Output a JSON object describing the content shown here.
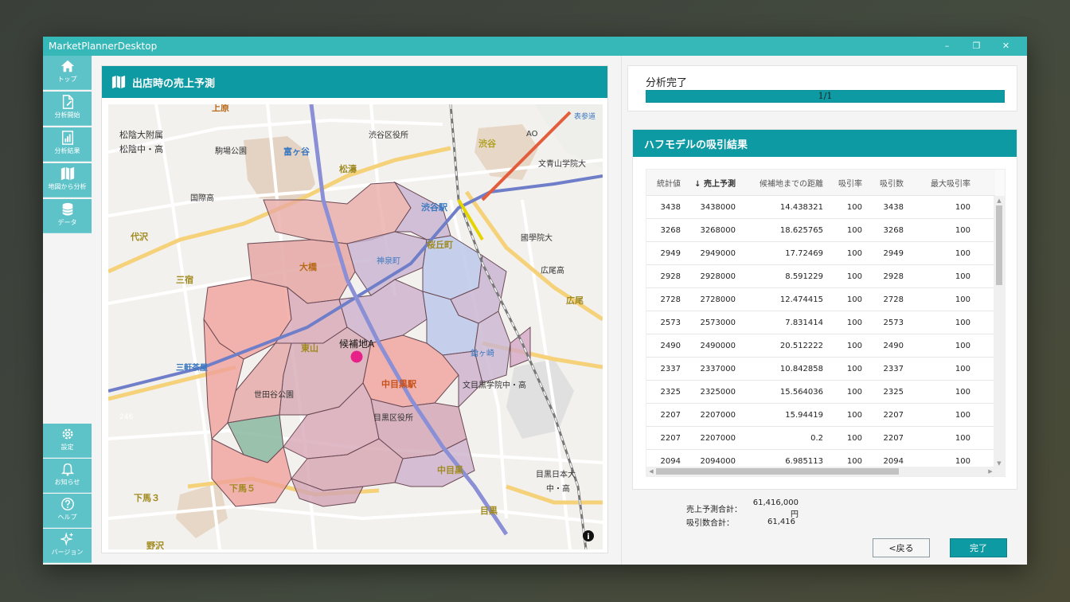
{
  "window": {
    "title": "MarketPlannerDesktop"
  },
  "title_controls": {
    "minimize": "–",
    "restore": "❐",
    "close": "✕"
  },
  "sidebar": {
    "top_items": [
      {
        "label": "トップ",
        "icon": "home-icon"
      },
      {
        "label": "分析開始",
        "icon": "file-edit-icon"
      },
      {
        "label": "分析結果",
        "icon": "report-icon"
      },
      {
        "label": "地図から分析",
        "icon": "map-icon"
      },
      {
        "label": "データ",
        "icon": "database-icon"
      }
    ],
    "bottom_items": [
      {
        "label": "設定",
        "icon": "gear-icon"
      },
      {
        "label": "お知らせ",
        "icon": "bell-icon"
      },
      {
        "label": "ヘルプ",
        "icon": "help-icon"
      },
      {
        "label": "バージョン",
        "icon": "sparkle-icon"
      }
    ]
  },
  "map_panel": {
    "title": "出店時の売上予測",
    "candidate_label": "候補地A",
    "places": {
      "p1": "上原",
      "p2": "松陰大附属",
      "p3": "松陰中・高",
      "p4": "駒場公園",
      "p5": "富ヶ谷",
      "p6": "渋谷区役所",
      "p7": "渋谷",
      "p8": "表参道",
      "p9": "松濤",
      "p10": "文青山学院大",
      "p11": "国際高",
      "p12": "渋谷駅",
      "p13": "代沢",
      "p14": "桜丘町",
      "p15": "國學院大",
      "p16": "三宿",
      "p17": "大橋",
      "p18": "神泉町",
      "p19": "広尾高",
      "p20": "広尾",
      "p21": "三軒茶屋",
      "p22": "東山",
      "p23": "中目黒駅",
      "p24": "鎗ヶ崎",
      "p25": "世田谷公園",
      "p26": "文目黒学院中・高",
      "p27": "目黒区役所",
      "p28": "中目黒",
      "p29": "下馬３",
      "p30": "下馬５",
      "p31": "目黒",
      "p32": "目黒日本大",
      "p33": "中・高",
      "p34": "野沢",
      "p35": "246",
      "p36": "AO"
    },
    "info_icon_label": "i"
  },
  "progress": {
    "status": "分析完了",
    "text": "1/1",
    "fraction": 1.0
  },
  "huff": {
    "title": "ハフモデルの吸引結果",
    "columns": [
      "統計値",
      "↓ 売上予測",
      "候補地までの距離",
      "吸引率",
      "吸引数",
      "最大吸引率"
    ],
    "rows": [
      [
        "3438",
        "3438000",
        "14.438321",
        "100",
        "3438",
        "100"
      ],
      [
        "3268",
        "3268000",
        "18.625765",
        "100",
        "3268",
        "100"
      ],
      [
        "2949",
        "2949000",
        "17.72469",
        "100",
        "2949",
        "100"
      ],
      [
        "2928",
        "2928000",
        "8.591229",
        "100",
        "2928",
        "100"
      ],
      [
        "2728",
        "2728000",
        "12.474415",
        "100",
        "2728",
        "100"
      ],
      [
        "2573",
        "2573000",
        "7.831414",
        "100",
        "2573",
        "100"
      ],
      [
        "2490",
        "2490000",
        "20.512222",
        "100",
        "2490",
        "100"
      ],
      [
        "2337",
        "2337000",
        "10.842858",
        "100",
        "2337",
        "100"
      ],
      [
        "2325",
        "2325000",
        "15.564036",
        "100",
        "2325",
        "100"
      ],
      [
        "2207",
        "2207000",
        "15.94419",
        "100",
        "2207",
        "100"
      ],
      [
        "2207",
        "2207000",
        "0.2",
        "100",
        "2207",
        "100"
      ],
      [
        "2094",
        "2094000",
        "6.985113",
        "100",
        "2094",
        "100"
      ]
    ]
  },
  "totals": {
    "sales_label": "売上予測合計：",
    "sales_value": "61,416,000円",
    "attract_label": "吸引数合計：",
    "attract_value": "61,416"
  },
  "buttons": {
    "back": "<戻る",
    "done": "完了"
  },
  "colors": {
    "accent": "#0d9aa3",
    "titlebar": "#37b8b8",
    "sidebar": "#5ec3c9",
    "candidate": "#e8208a"
  }
}
